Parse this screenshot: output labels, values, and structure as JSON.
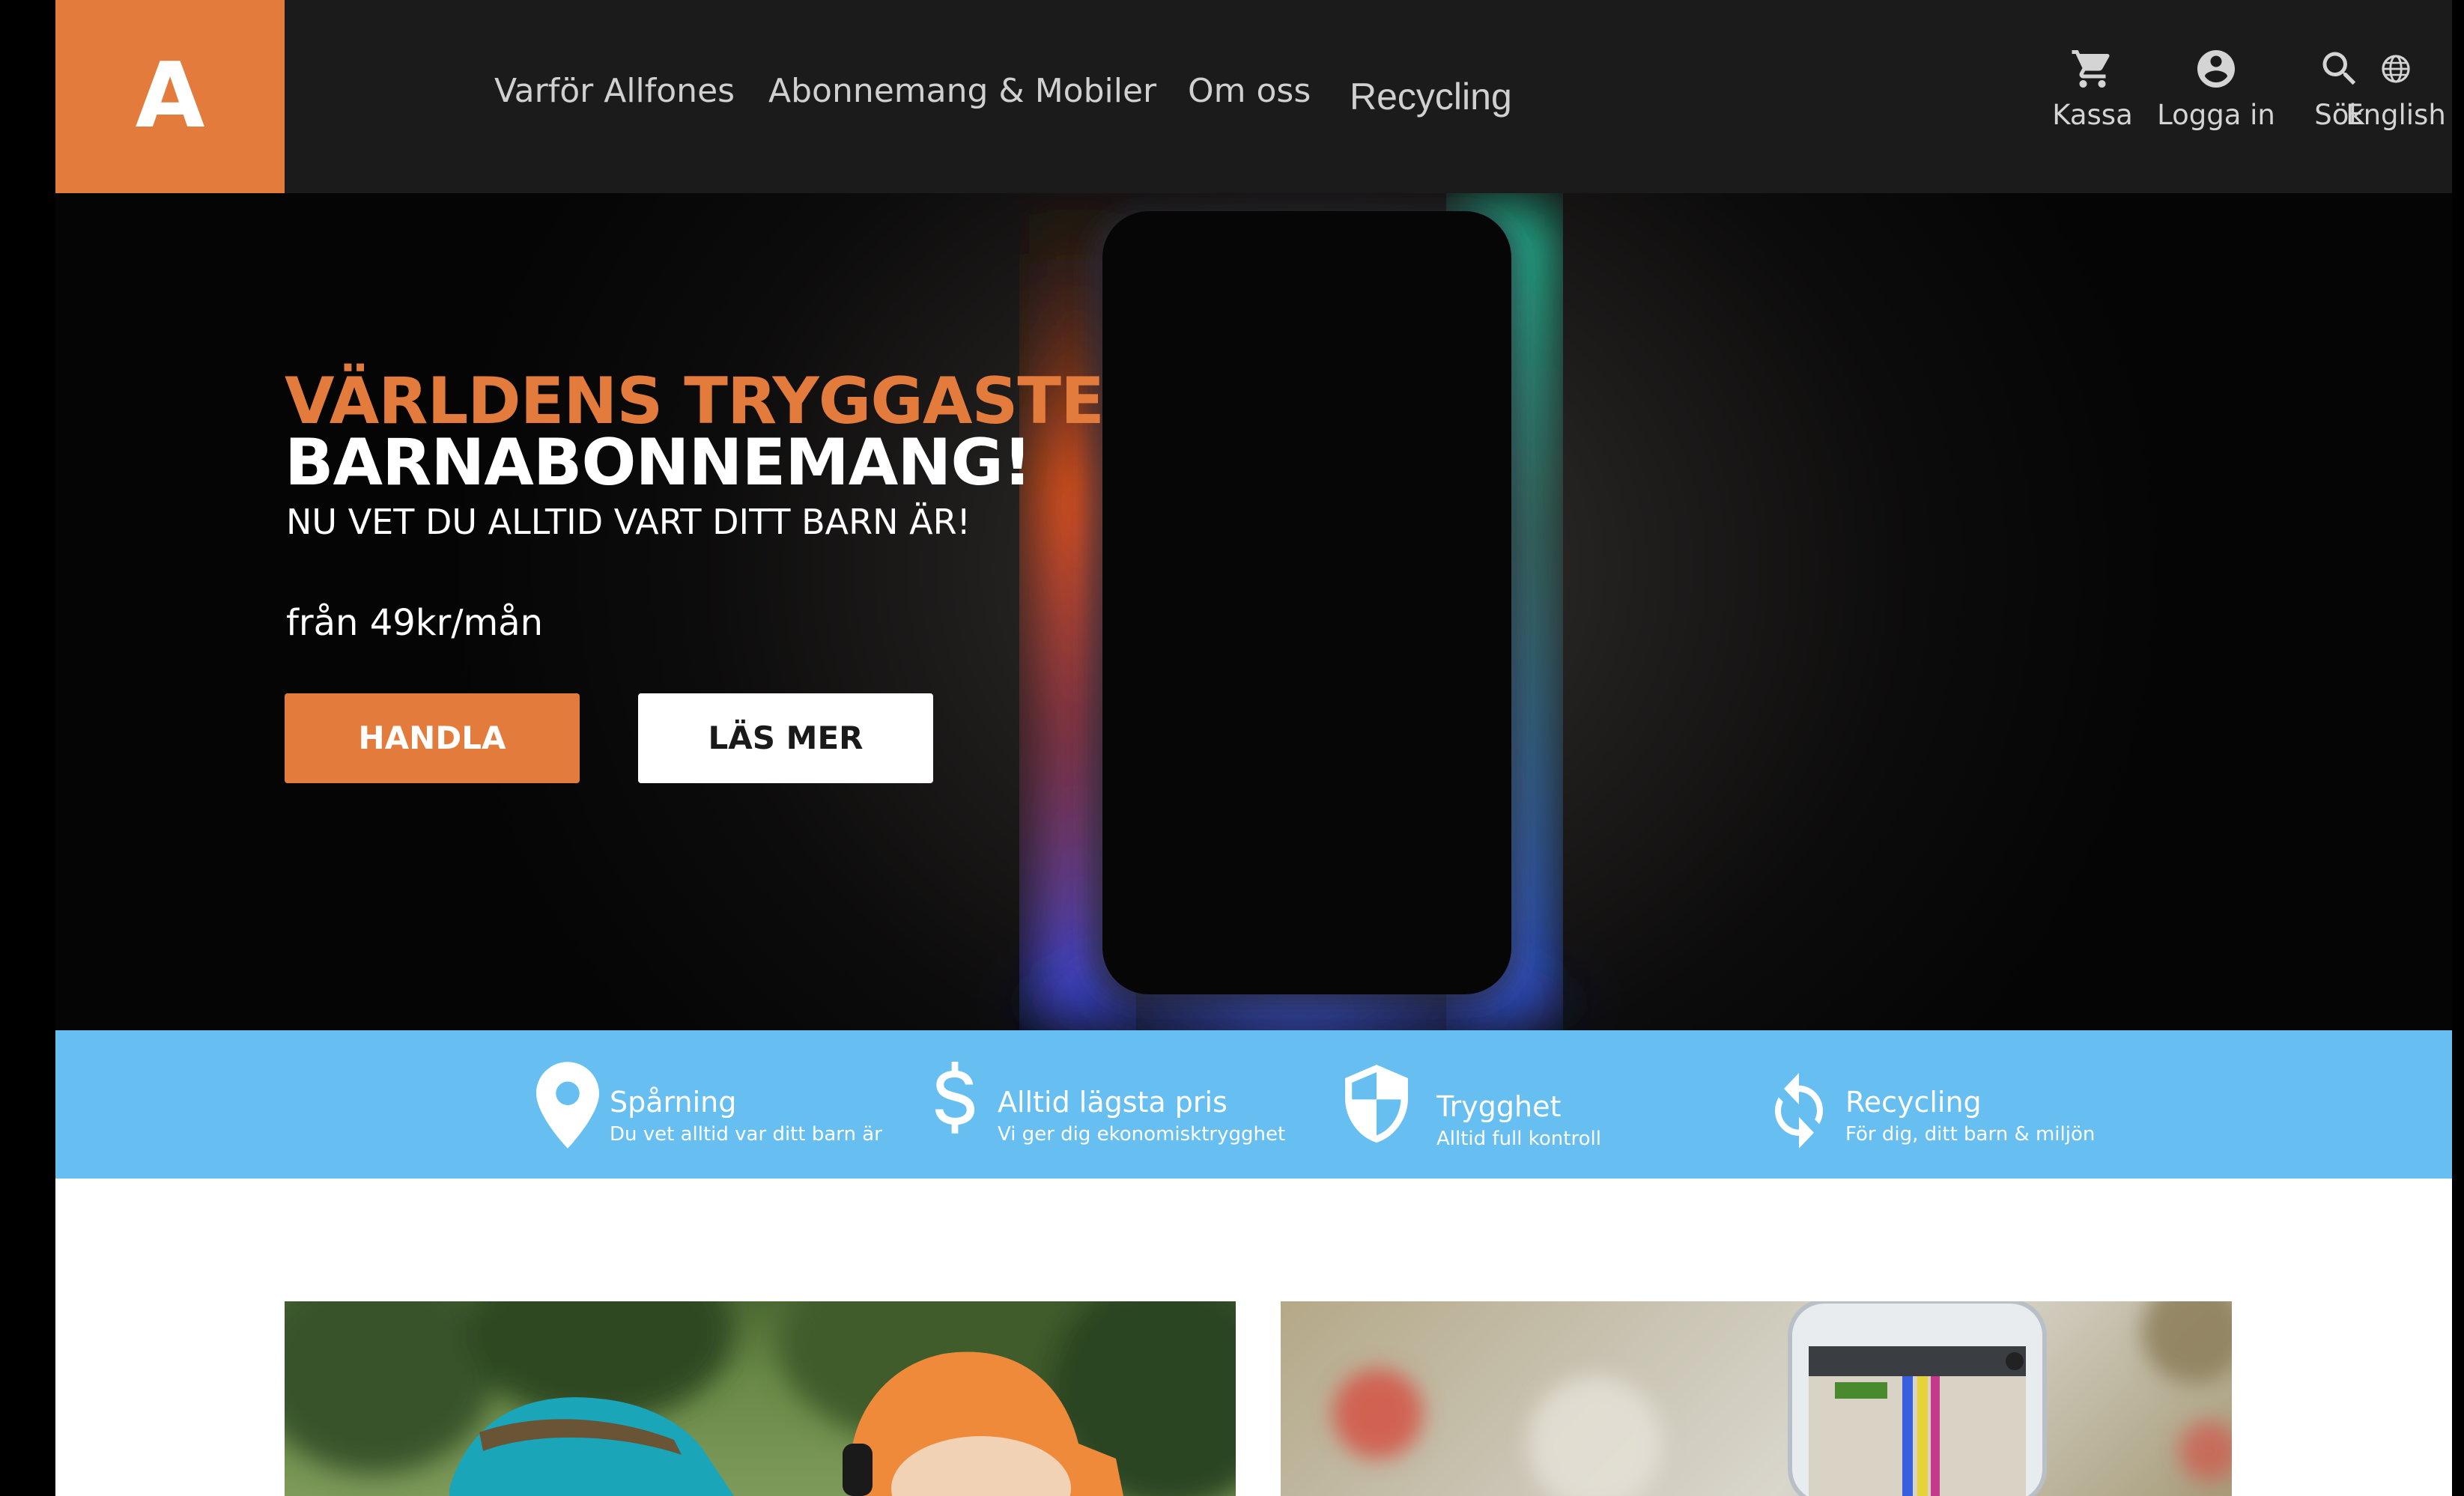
{
  "brand": {
    "logo_letter": "A",
    "accent_color": "#e27b3b"
  },
  "nav": {
    "items": [
      {
        "label": "Varför Allfones"
      },
      {
        "label": "Abonnemang & Mobiler"
      },
      {
        "label": "Om oss"
      },
      {
        "label": "Recycling"
      }
    ]
  },
  "utility": {
    "checkout": {
      "label": "Kassa",
      "icon": "cart-icon"
    },
    "login": {
      "label": "Logga in",
      "icon": "account-icon"
    },
    "search": {
      "label": "Sök",
      "icon": "search-icon"
    },
    "language": {
      "label": "English",
      "icon": "globe-icon"
    }
  },
  "hero": {
    "title_line1": "VÄRLDENS TRYGGASTE",
    "title_line2": "BARNABONNEMANG!",
    "subtitle": "NU VET DU ALLTID VART DITT BARN ÄR!",
    "price": "från 49kr/mån",
    "primary_button": "HANDLA",
    "secondary_button": "LÄS MER"
  },
  "features": {
    "background_color": "#66bff0",
    "items": [
      {
        "title": "Spårning",
        "subtitle": "Du vet alltid var ditt barn är",
        "icon": "location-pin-icon"
      },
      {
        "title": "Alltid lägsta pris",
        "subtitle": "Vi ger dig ekonomisktrygghet",
        "icon": "dollar-icon"
      },
      {
        "title": "Trygghet",
        "subtitle": "Alltid full kontroll",
        "icon": "shield-icon"
      },
      {
        "title": "Recycling",
        "subtitle": "För dig, ditt barn & miljön",
        "icon": "recycle-icon"
      }
    ]
  },
  "cards": [
    {
      "image": "children-with-hats-photo"
    },
    {
      "image": "phone-navigation-photo"
    }
  ]
}
